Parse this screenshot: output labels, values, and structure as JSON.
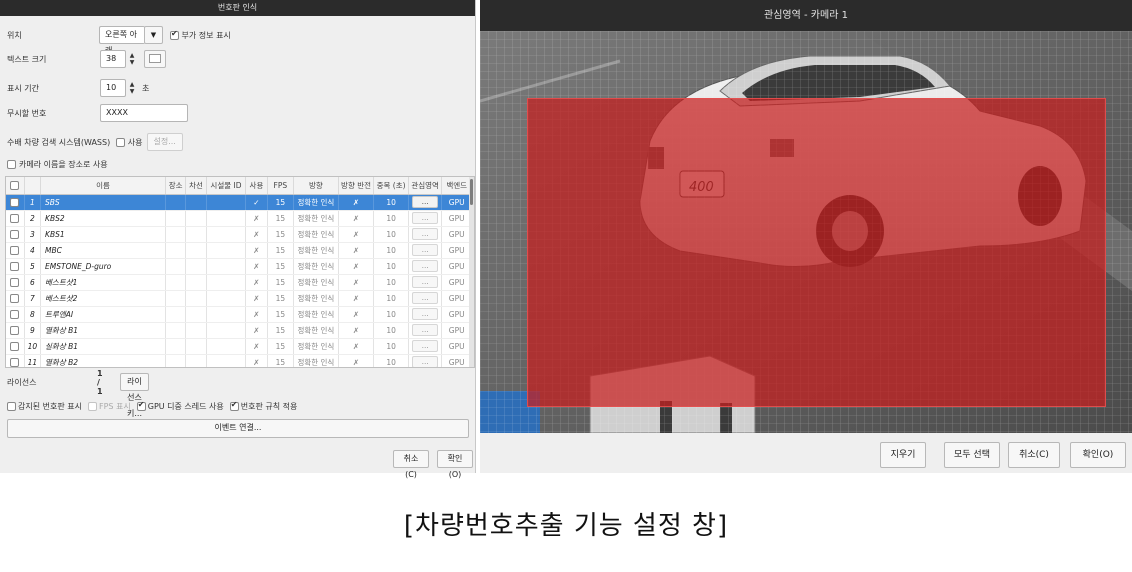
{
  "left_dialog": {
    "title": "번호판 인식",
    "position": {
      "label": "위치",
      "value": "오른쪽 아래",
      "extra_info_label": "부가 정보 표시",
      "extra_info_checked": true
    },
    "text_size": {
      "label": "텍스트 크기",
      "value": "38",
      "color": "#ffffff"
    },
    "display_duration": {
      "label": "표시 기간",
      "value": "10",
      "unit": "초"
    },
    "ignore_plate": {
      "label": "무시할 번호",
      "value": "XXXX"
    },
    "wass": {
      "label": "수배 차량 검색 시스템(WASS)",
      "use_label": "사용",
      "use_checked": false,
      "settings_button": "설정..."
    },
    "camera_name_as_location": {
      "label": "카메라 이름을 장소로 사용",
      "checked": false
    },
    "table": {
      "columns": [
        "",
        "",
        "이름",
        "장소",
        "차선",
        "시설물 ID",
        "사용",
        "FPS",
        "방향",
        "방향 반전",
        "중복 (초)",
        "관심영역",
        "백엔드"
      ],
      "selected_row": 0,
      "rows": [
        {
          "no": "1",
          "name": "SBS",
          "use": "✓",
          "fps": "15",
          "direction": "정확한 인식",
          "reverse": "✗",
          "dup": "10",
          "roi": "...",
          "backend": "GPU"
        },
        {
          "no": "2",
          "name": "KBS2",
          "use": "✗",
          "fps": "15",
          "direction": "정확한 인식",
          "reverse": "✗",
          "dup": "10",
          "roi": "...",
          "backend": "GPU"
        },
        {
          "no": "3",
          "name": "KBS1",
          "use": "✗",
          "fps": "15",
          "direction": "정확한 인식",
          "reverse": "✗",
          "dup": "10",
          "roi": "...",
          "backend": "GPU"
        },
        {
          "no": "4",
          "name": "MBC",
          "use": "✗",
          "fps": "15",
          "direction": "정확한 인식",
          "reverse": "✗",
          "dup": "10",
          "roi": "...",
          "backend": "GPU"
        },
        {
          "no": "5",
          "name": "EMSTONE_D-guro",
          "use": "✗",
          "fps": "15",
          "direction": "정확한 인식",
          "reverse": "✗",
          "dup": "10",
          "roi": "...",
          "backend": "GPU"
        },
        {
          "no": "6",
          "name": "베스트샷1",
          "use": "✗",
          "fps": "15",
          "direction": "정확한 인식",
          "reverse": "✗",
          "dup": "10",
          "roi": "...",
          "backend": "GPU"
        },
        {
          "no": "7",
          "name": "베스트샷2",
          "use": "✗",
          "fps": "15",
          "direction": "정확한 인식",
          "reverse": "✗",
          "dup": "10",
          "roi": "...",
          "backend": "GPU"
        },
        {
          "no": "8",
          "name": "트루엔AI",
          "use": "✗",
          "fps": "15",
          "direction": "정확한 인식",
          "reverse": "✗",
          "dup": "10",
          "roi": "...",
          "backend": "GPU"
        },
        {
          "no": "9",
          "name": "열화상 B1",
          "use": "✗",
          "fps": "15",
          "direction": "정확한 인식",
          "reverse": "✗",
          "dup": "10",
          "roi": "...",
          "backend": "GPU"
        },
        {
          "no": "10",
          "name": "실화상 B1",
          "use": "✗",
          "fps": "15",
          "direction": "정확한 인식",
          "reverse": "✗",
          "dup": "10",
          "roi": "...",
          "backend": "GPU"
        },
        {
          "no": "11",
          "name": "열화상 B2",
          "use": "✗",
          "fps": "15",
          "direction": "정확한 인식",
          "reverse": "✗",
          "dup": "10",
          "roi": "...",
          "backend": "GPU"
        }
      ]
    },
    "license": {
      "label": "라이선스",
      "value": "1 / 1",
      "button": "라이선스 키..."
    },
    "options": [
      {
        "label": "감지된 번호판 표시",
        "checked": false,
        "disabled": false
      },
      {
        "label": "FPS 표시",
        "checked": false,
        "disabled": true
      },
      {
        "label": "GPU 디중 스레드 사용",
        "checked": true,
        "disabled": false
      },
      {
        "label": "번호판 규칙 적용",
        "checked": true,
        "disabled": false
      }
    ],
    "event_link_button": "이벤트 연결...",
    "cancel_button": "취소(C)",
    "ok_button": "확인(O)"
  },
  "right_dialog": {
    "title": "관심영역 - 카메라 1",
    "clear_button": "지우기",
    "select_all_button": "모두 선택",
    "cancel_button": "취소(C)",
    "ok_button": "확인(O)",
    "plate_text": "400",
    "roi_color": "#c81e1e"
  },
  "caption": "[차량번호추출 기능 설정 창]"
}
